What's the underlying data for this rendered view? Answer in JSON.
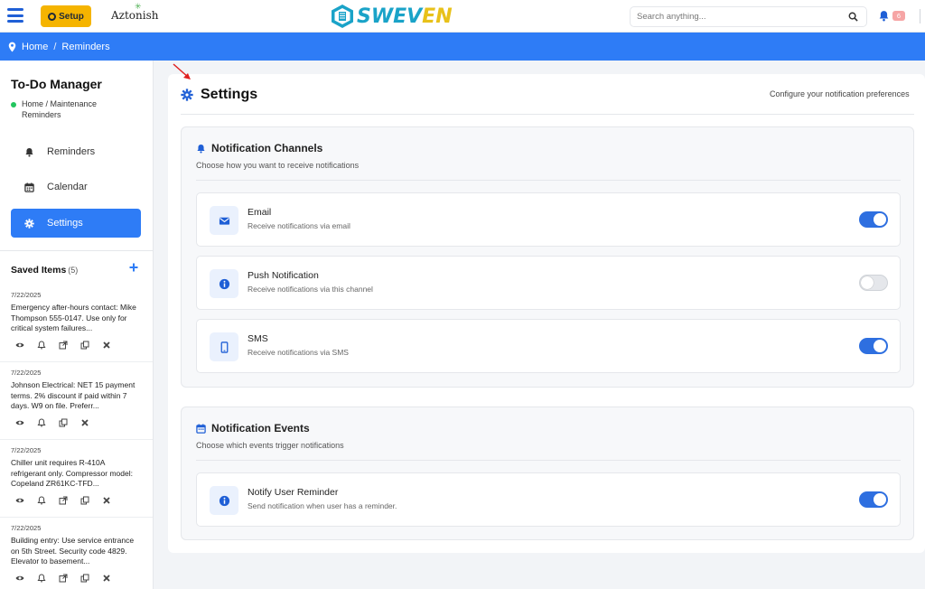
{
  "topbar": {
    "setup_label": "Setup",
    "brand_small": "Aztonish",
    "logo_part1": "SWEV",
    "logo_part2": "EN",
    "search_placeholder": "Search anything...",
    "notification_count": "6"
  },
  "breadcrumb": {
    "home": "Home",
    "separator": "/",
    "current": "Reminders"
  },
  "sidebar": {
    "title": "To-Do Manager",
    "path": "Home / Maintenance Reminders",
    "nav": [
      {
        "label": "Reminders",
        "icon": "bell-icon",
        "active": false
      },
      {
        "label": "Calendar",
        "icon": "calendar-icon",
        "active": false
      },
      {
        "label": "Settings",
        "icon": "gear-icon",
        "active": true
      }
    ],
    "saved_title": "Saved Items",
    "saved_count": "(5)",
    "saved_items": [
      {
        "date": "7/22/2025",
        "text": "Emergency after-hours contact: Mike Thompson 555-0147. Use only for critical system failures..."
      },
      {
        "date": "7/22/2025",
        "text": "Johnson Electrical: NET 15 payment terms. 2% discount if paid within 7 days. W9 on file. Preferr..."
      },
      {
        "date": "7/22/2025",
        "text": "Chiller unit requires R-410A refrigerant only. Compressor model: Copeland ZR61KC-TFD..."
      },
      {
        "date": "7/22/2025",
        "text": "Building entry: Use service entrance on 5th Street. Security code 4829. Elevator to basement..."
      }
    ]
  },
  "settings": {
    "title": "Settings",
    "subtitle": "Configure your notification preferences",
    "channels": {
      "title": "Notification Channels",
      "subtitle": "Choose how you want to receive notifications",
      "items": [
        {
          "title": "Email",
          "desc": "Receive notifications via email",
          "icon": "envelope-icon",
          "enabled": true
        },
        {
          "title": "Push Notification",
          "desc": "Receive notifications via this channel",
          "icon": "info-icon",
          "enabled": false
        },
        {
          "title": "SMS",
          "desc": "Receive notifications via SMS",
          "icon": "mobile-icon",
          "enabled": true
        }
      ]
    },
    "events": {
      "title": "Notification Events",
      "subtitle": "Choose which events trigger notifications",
      "items": [
        {
          "title": "Notify User Reminder",
          "desc": "Send notification when user has a reminder.",
          "icon": "info-icon",
          "enabled": true
        }
      ]
    }
  },
  "colors": {
    "primary": "#2e7cf6",
    "setup": "#f5b400",
    "toggle_on": "#2e6fe0",
    "annotation_arrow": "#e02020"
  }
}
